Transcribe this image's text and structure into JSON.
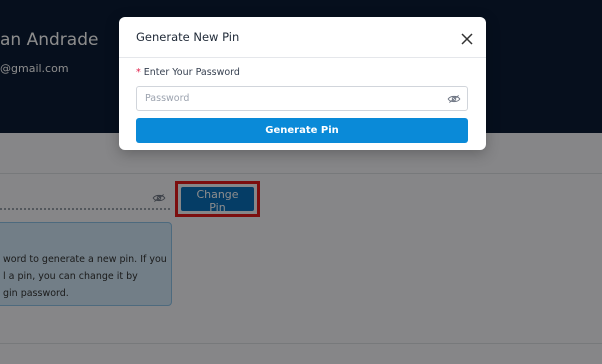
{
  "profile": {
    "name_partial": "an Andrade",
    "email_partial": "@gmail.com"
  },
  "security": {
    "change_pin_label": "Change Pin",
    "info_text_lines": [
      "word to generate a new pin. If you",
      "l a pin, you can change it by",
      "gin password."
    ]
  },
  "modal": {
    "title": "Generate New Pin",
    "password_label": "Enter Your Password",
    "password_placeholder": "Password",
    "generate_button": "Generate Pin"
  },
  "colors": {
    "header_bg": "#0b1c35",
    "primary_button": "#0a8ad8",
    "change_button": "#0a6fbb",
    "highlight_border": "#e21b1b"
  },
  "icons": {
    "close": "close-icon",
    "eye_off": "eye-off-icon"
  }
}
